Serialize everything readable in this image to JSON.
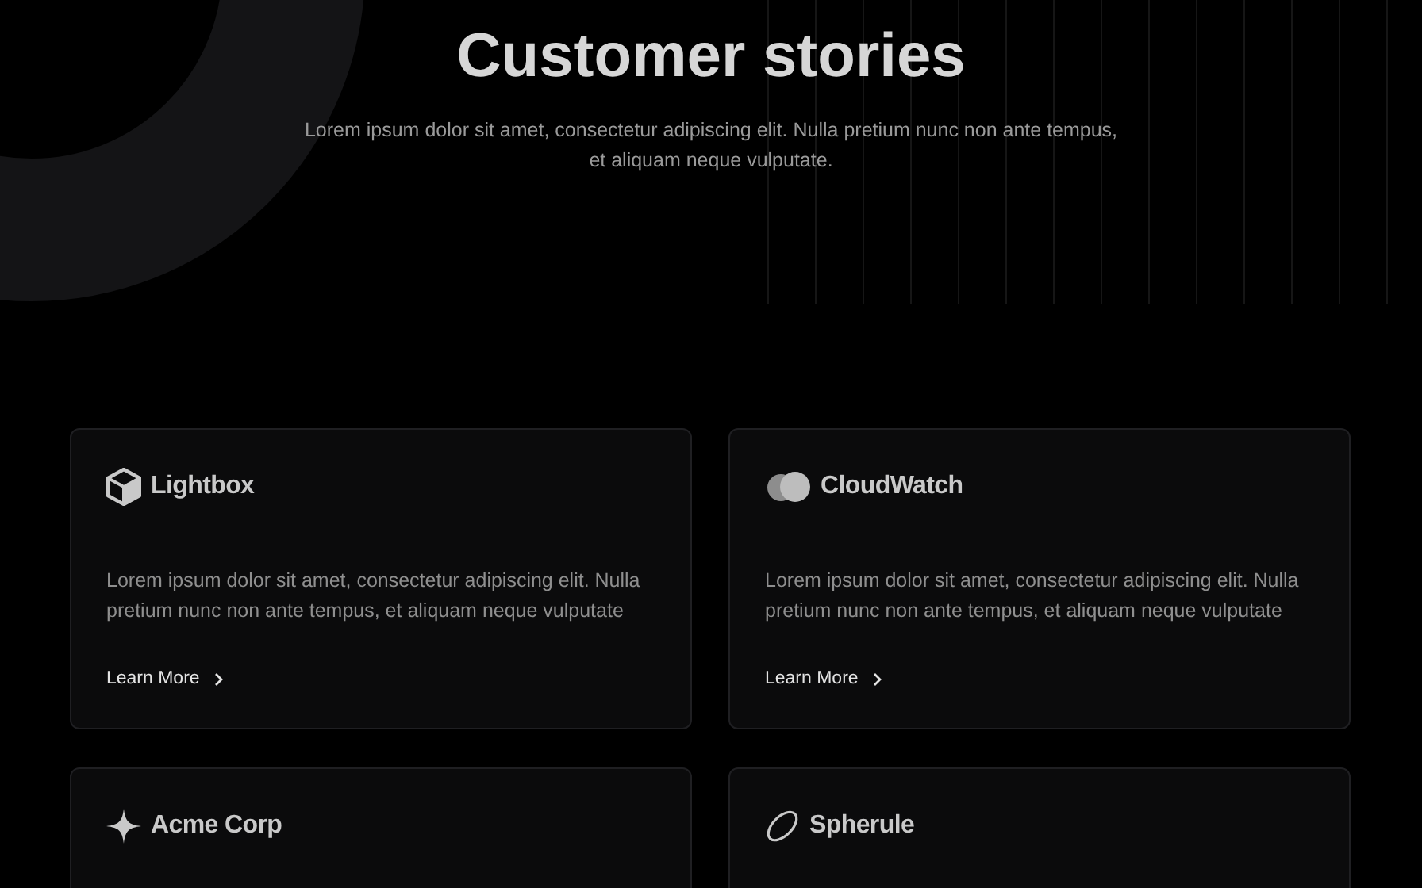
{
  "header": {
    "title": "Customer stories",
    "subtitle": "Lorem ipsum dolor sit amet, consectetur adipiscing elit. Nulla pretium nunc non ante tempus, et aliquam neque vulputate."
  },
  "stories": [
    {
      "company": "Lightbox",
      "text": "Lorem ipsum dolor sit amet, consectetur adipiscing elit. Nulla pretium nunc non ante tempus, et aliquam neque vulputate",
      "link": "Learn More"
    },
    {
      "company": "CloudWatch",
      "text": "Lorem ipsum dolor sit amet, consectetur adipiscing elit. Nulla pretium nunc non ante tempus, et aliquam neque vulputate",
      "link": "Learn More"
    },
    {
      "company": "Acme Corp"
    },
    {
      "company": "Spherule"
    }
  ]
}
